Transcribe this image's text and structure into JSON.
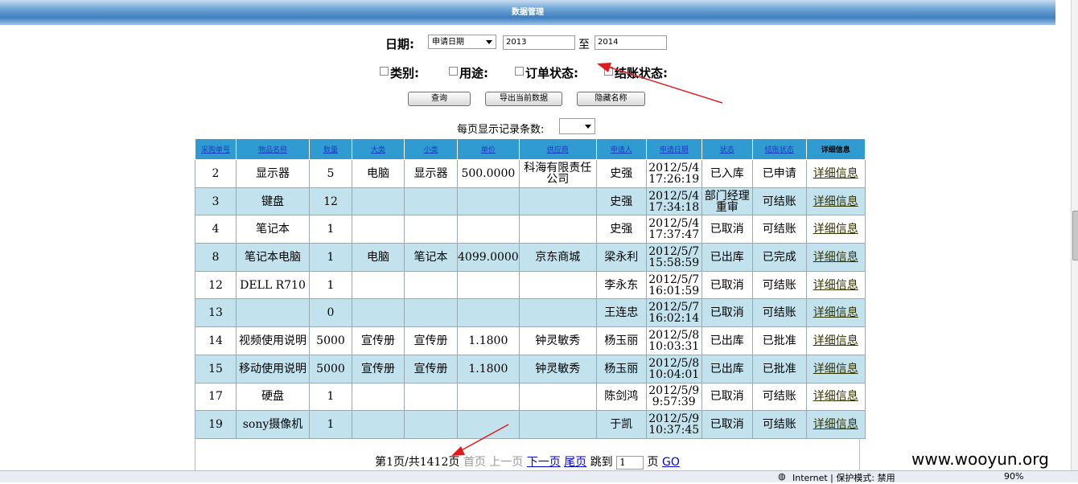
{
  "header": {
    "title": "数据管理"
  },
  "filters": {
    "date_label": "日期:",
    "date_type": "申请日期",
    "date_from": "2013",
    "to_label": "至",
    "date_to": "2014",
    "category_label": "类别:",
    "usage_label": "用途:",
    "order_status_label": "订单状态:",
    "settle_status_label": "结账状态:",
    "query_button": "查询",
    "export_button": "导出当前数据",
    "hide_names_button": "隐藏名称",
    "per_page_label": "每页显示记录条数:",
    "per_page_value": ""
  },
  "table": {
    "headers": [
      "采购单号",
      "物品名称",
      "数量",
      "大类",
      "小类",
      "单价",
      "供应商",
      "申请人",
      "申请日期",
      "状态",
      "结账状态",
      "详细信息"
    ],
    "rows": [
      [
        "2",
        "显示器",
        "5",
        "电脑",
        "显示器",
        "500.0000",
        "科海有限责任公司",
        "史强",
        "2012/5/4 17:26:19",
        "已入库",
        "已申请",
        "详细信息"
      ],
      [
        "3",
        "键盘",
        "12",
        "",
        "",
        "",
        "",
        "史强",
        "2012/5/4 17:34:18",
        "部门经理重审",
        "可结账",
        "详细信息"
      ],
      [
        "4",
        "笔记本",
        "1",
        "",
        "",
        "",
        "",
        "史强",
        "2012/5/4 17:37:47",
        "已取消",
        "可结账",
        "详细信息"
      ],
      [
        "8",
        "笔记本电脑",
        "1",
        "电脑",
        "笔记本",
        "4099.0000",
        "京东商城",
        "梁永利",
        "2012/5/7 15:58:59",
        "已出库",
        "已完成",
        "详细信息"
      ],
      [
        "12",
        "DELL R710",
        "1",
        "",
        "",
        "",
        "",
        "李永东",
        "2012/5/7 16:01:59",
        "已取消",
        "可结账",
        "详细信息"
      ],
      [
        "13",
        "",
        "0",
        "",
        "",
        "",
        "",
        "王连忠",
        "2012/5/7 16:02:14",
        "已取消",
        "可结账",
        "详细信息"
      ],
      [
        "14",
        "视频使用说明",
        "5000",
        "宣传册",
        "宣传册",
        "1.1800",
        "钟灵敏秀",
        "杨玉丽",
        "2012/5/8 10:03:31",
        "已出库",
        "已批准",
        "详细信息"
      ],
      [
        "15",
        "移动使用说明",
        "5000",
        "宣传册",
        "宣传册",
        "1.1800",
        "钟灵敏秀",
        "杨玉丽",
        "2012/5/8 10:04:01",
        "已出库",
        "已批准",
        "详细信息"
      ],
      [
        "17",
        "硬盘",
        "1",
        "",
        "",
        "",
        "",
        "陈剑鸿",
        "2012/5/9 9:57:39",
        "已取消",
        "可结账",
        "详细信息"
      ],
      [
        "19",
        "sony摄像机",
        "1",
        "",
        "",
        "",
        "",
        "于凯",
        "2012/5/9 10:37:45",
        "已取消",
        "可结账",
        "详细信息"
      ]
    ]
  },
  "pager": {
    "summary": "第1页/共1412页",
    "first": "首页",
    "prev": "上一页",
    "next": "下一页",
    "last": "尾页",
    "jump_label": "跳到",
    "jump_value": "1",
    "page_unit": "页",
    "go": "GO"
  },
  "statusbar": {
    "zone": "Internet | 保护模式: 禁用",
    "zoom": "90%"
  },
  "watermark": "www.wooyun.org",
  "colors": {
    "header_bg": "#2f9bd1",
    "alt_row_bg": "#c2e3ee",
    "annotation_arrow": "#e0191b"
  }
}
